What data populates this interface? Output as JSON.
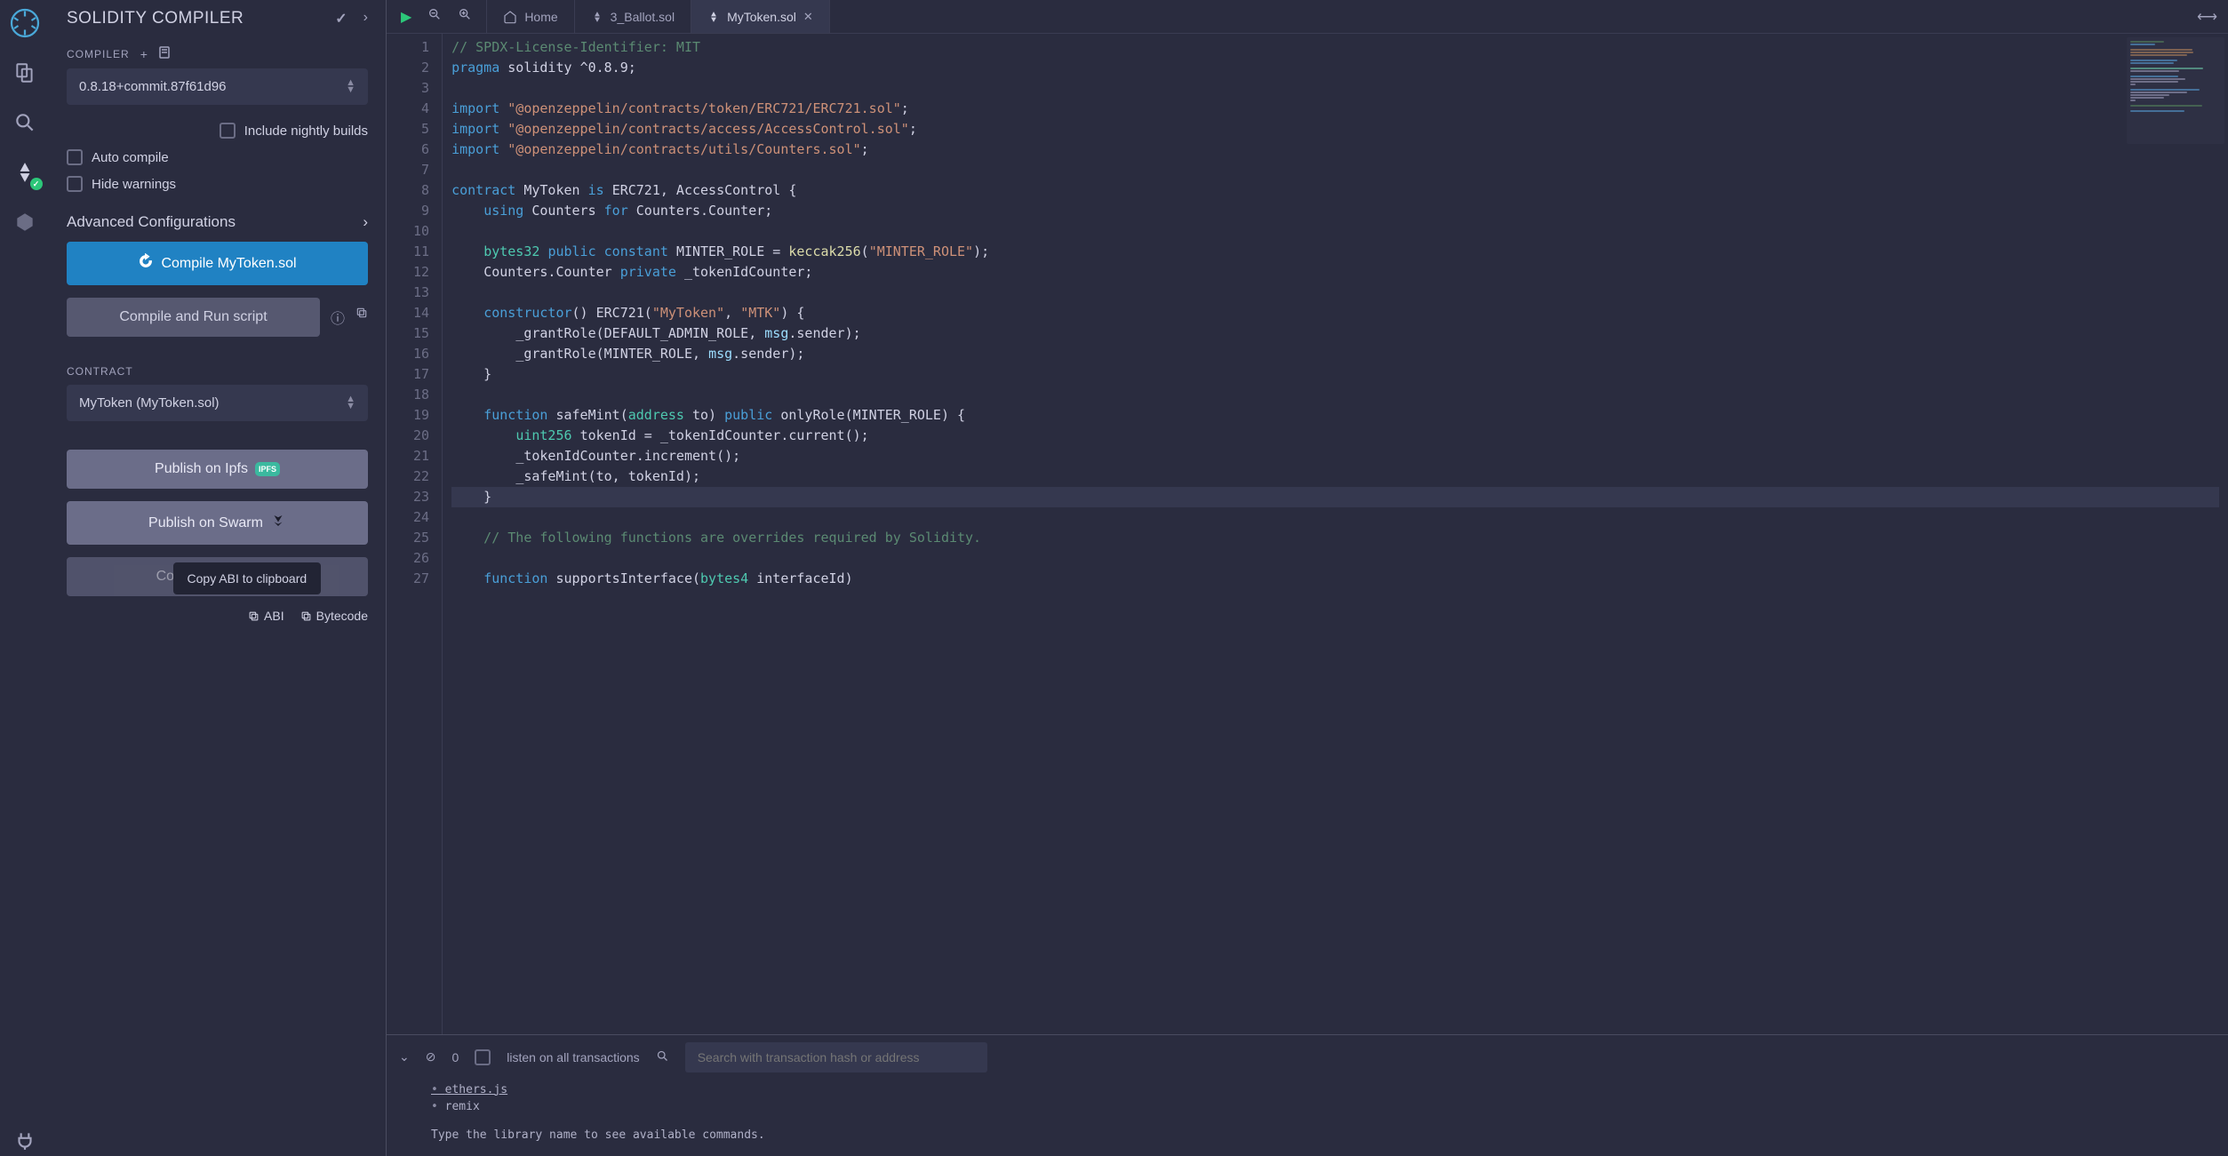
{
  "sidepanel": {
    "title": "SOLIDITY COMPILER",
    "compiler_label": "COMPILER",
    "compiler_version": "0.8.18+commit.87f61d96",
    "nightly_label": "Include nightly builds",
    "auto_compile_label": "Auto compile",
    "hide_warnings_label": "Hide warnings",
    "advanced_label": "Advanced Configurations",
    "compile_btn": "Compile MyToken.sol",
    "compile_run_btn": "Compile and Run script",
    "contract_label": "CONTRACT",
    "contract_value": "MyToken (MyToken.sol)",
    "publish_ipfs": "Publish on Ipfs",
    "publish_swarm": "Publish on Swarm",
    "compilation_details": "Compilation Details",
    "tooltip": "Copy ABI to clipboard",
    "abi_label": "ABI",
    "bytecode_label": "Bytecode"
  },
  "tabs": {
    "home": "Home",
    "ballot": "3_Ballot.sol",
    "mytoken": "MyToken.sol"
  },
  "code": {
    "lines": [
      {
        "n": 1,
        "t": "comment",
        "s": "// SPDX-License-Identifier: MIT"
      },
      {
        "n": 2,
        "t": "pragma",
        "s": "pragma solidity ^0.8.9;"
      },
      {
        "n": 3,
        "t": "blank",
        "s": ""
      },
      {
        "n": 4,
        "t": "import",
        "s": "import \"@openzeppelin/contracts/token/ERC721/ERC721.sol\";"
      },
      {
        "n": 5,
        "t": "import",
        "s": "import \"@openzeppelin/contracts/access/AccessControl.sol\";"
      },
      {
        "n": 6,
        "t": "import",
        "s": "import \"@openzeppelin/contracts/utils/Counters.sol\";"
      },
      {
        "n": 7,
        "t": "blank",
        "s": ""
      },
      {
        "n": 8,
        "t": "contract",
        "s": "contract MyToken is ERC721, AccessControl {"
      },
      {
        "n": 9,
        "t": "using",
        "s": "    using Counters for Counters.Counter;"
      },
      {
        "n": 10,
        "t": "blank",
        "s": ""
      },
      {
        "n": 11,
        "t": "const",
        "s": "    bytes32 public constant MINTER_ROLE = keccak256(\"MINTER_ROLE\");"
      },
      {
        "n": 12,
        "t": "decl",
        "s": "    Counters.Counter private _tokenIdCounter;"
      },
      {
        "n": 13,
        "t": "blank",
        "s": ""
      },
      {
        "n": 14,
        "t": "ctor",
        "s": "    constructor() ERC721(\"MyToken\", \"MTK\") {"
      },
      {
        "n": 15,
        "t": "body",
        "s": "        _grantRole(DEFAULT_ADMIN_ROLE, msg.sender);"
      },
      {
        "n": 16,
        "t": "body",
        "s": "        _grantRole(MINTER_ROLE, msg.sender);"
      },
      {
        "n": 17,
        "t": "close",
        "s": "    }"
      },
      {
        "n": 18,
        "t": "blank",
        "s": ""
      },
      {
        "n": 19,
        "t": "fn",
        "s": "    function safeMint(address to) public onlyRole(MINTER_ROLE) {"
      },
      {
        "n": 20,
        "t": "body2",
        "s": "        uint256 tokenId = _tokenIdCounter.current();"
      },
      {
        "n": 21,
        "t": "body3",
        "s": "        _tokenIdCounter.increment();"
      },
      {
        "n": 22,
        "t": "body3",
        "s": "        _safeMint(to, tokenId);"
      },
      {
        "n": 23,
        "t": "close",
        "s": "    }",
        "hl": true
      },
      {
        "n": 24,
        "t": "blank",
        "s": ""
      },
      {
        "n": 25,
        "t": "comment",
        "s": "    // The following functions are overrides required by Solidity."
      },
      {
        "n": 26,
        "t": "blank",
        "s": ""
      },
      {
        "n": 27,
        "t": "fn2",
        "s": "    function supportsInterface(bytes4 interfaceId)"
      }
    ]
  },
  "bottom": {
    "count": "0",
    "listen_label": "listen on all transactions",
    "search_placeholder": "Search with transaction hash or address",
    "term_line1": "ethers.js",
    "term_line2": "remix",
    "term_hint": "Type the library name to see available commands."
  }
}
